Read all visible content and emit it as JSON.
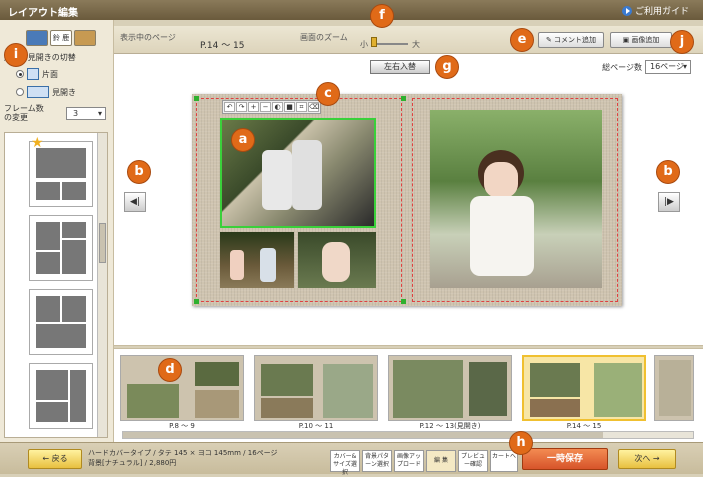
{
  "window": {
    "title": "レイアウト編集",
    "guide_label": "ご利用ガイド"
  },
  "sidebar": {
    "tabs": [
      "",
      "鈴 鹿",
      ""
    ],
    "view_toggle_label": "片面 / 見開きの切替",
    "view_options": [
      "片面",
      "見開き"
    ],
    "frame_count_label": "フレーム数の変更",
    "frame_count_value": "3"
  },
  "infobar": {
    "current_page_label": "表示中のページ",
    "current_page_value": "P.14 〜 15",
    "zoom_label": "画面のズーム",
    "zoom_min": "小",
    "zoom_max": "大",
    "comment_button": "コメント追加",
    "image_button": "画像追加"
  },
  "workspace": {
    "swap_button": "左右入替",
    "total_pages_label": "総ページ数",
    "total_pages_value": "16ページ"
  },
  "filmstrip": {
    "items": [
      {
        "label": "P.8 〜 9"
      },
      {
        "label": "P.10 〜 11"
      },
      {
        "label": "P.12 〜 13(見開き)"
      },
      {
        "label": "P.14 〜 15"
      }
    ]
  },
  "bottombar": {
    "back_button": "← 戻る",
    "product_line1": "ハードカバータイプ / タテ 145 × ヨコ 145mm / 16ページ",
    "product_line2": "背景[ナチュラル] / 2,880円",
    "steps": [
      "カバー&サイズ選択",
      "背景パターン選択",
      "画像アップロード",
      "編 集",
      "プレビュー確認",
      "カートへ"
    ],
    "save_button": "一時保存",
    "next_button": "次へ →"
  },
  "callouts": [
    "a",
    "b",
    "b",
    "c",
    "d",
    "e",
    "f",
    "g",
    "h",
    "i",
    "j"
  ],
  "colors": {
    "callout": "#e06a18",
    "selected_frame": "#3ad03a",
    "page_guide": "#e04040",
    "save": "#d7542a"
  }
}
